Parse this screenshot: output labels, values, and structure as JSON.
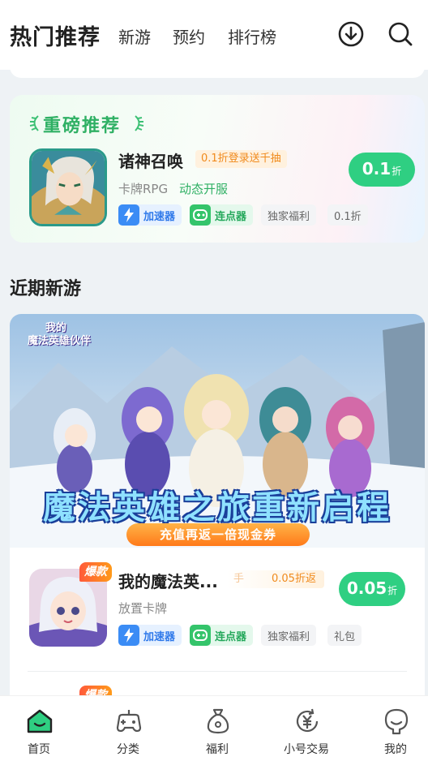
{
  "header": {
    "title": "热门推荐",
    "tabs": [
      "新游",
      "预约",
      "排行榜"
    ],
    "icons": [
      "download-icon",
      "search-icon"
    ]
  },
  "featured": {
    "section_label": "重磅推荐",
    "game": {
      "name": "诸神召唤",
      "promo": "0.1折登录送千抽",
      "category": "卡牌RPG",
      "subtitle": "动态开服",
      "chips": {
        "accelerator": "加速器",
        "clicker": "连点器",
        "exclusive": "独家福利",
        "discount": "0.1折"
      },
      "discount_value": "0.1",
      "discount_unit": "折"
    }
  },
  "recent": {
    "section_title": "近期新游",
    "banner": {
      "logo_line1": "我的",
      "logo_line2": "魔法英雄伙伴",
      "headline": "魔法英雄之旅重新启程",
      "ribbon": "充值再返一倍现金券"
    },
    "game": {
      "hot_badge": "爆款",
      "name": "我的魔法英...",
      "promo_prefix": "手",
      "promo": "0.05折返",
      "category": "放置卡牌",
      "chips": {
        "accelerator": "加速器",
        "clicker": "连点器",
        "exclusive": "独家福利",
        "gift": "礼包"
      },
      "discount_value": "0.05",
      "discount_unit": "折"
    },
    "next_hot_badge": "爆款"
  },
  "tabbar": {
    "items": [
      {
        "label": "首页",
        "icon": "home-icon",
        "active": true
      },
      {
        "label": "分类",
        "icon": "gamepad-icon",
        "active": false
      },
      {
        "label": "福利",
        "icon": "money-bag-icon",
        "active": false
      },
      {
        "label": "小号交易",
        "icon": "trade-icon",
        "active": false
      },
      {
        "label": "我的",
        "icon": "profile-icon",
        "active": false
      }
    ]
  },
  "colors": {
    "accent": "#2fcf82",
    "accent_text": "#2fb064",
    "promo": "#f08a1c",
    "accelerator": "#3b8cf5",
    "clicker": "#34c46b"
  }
}
